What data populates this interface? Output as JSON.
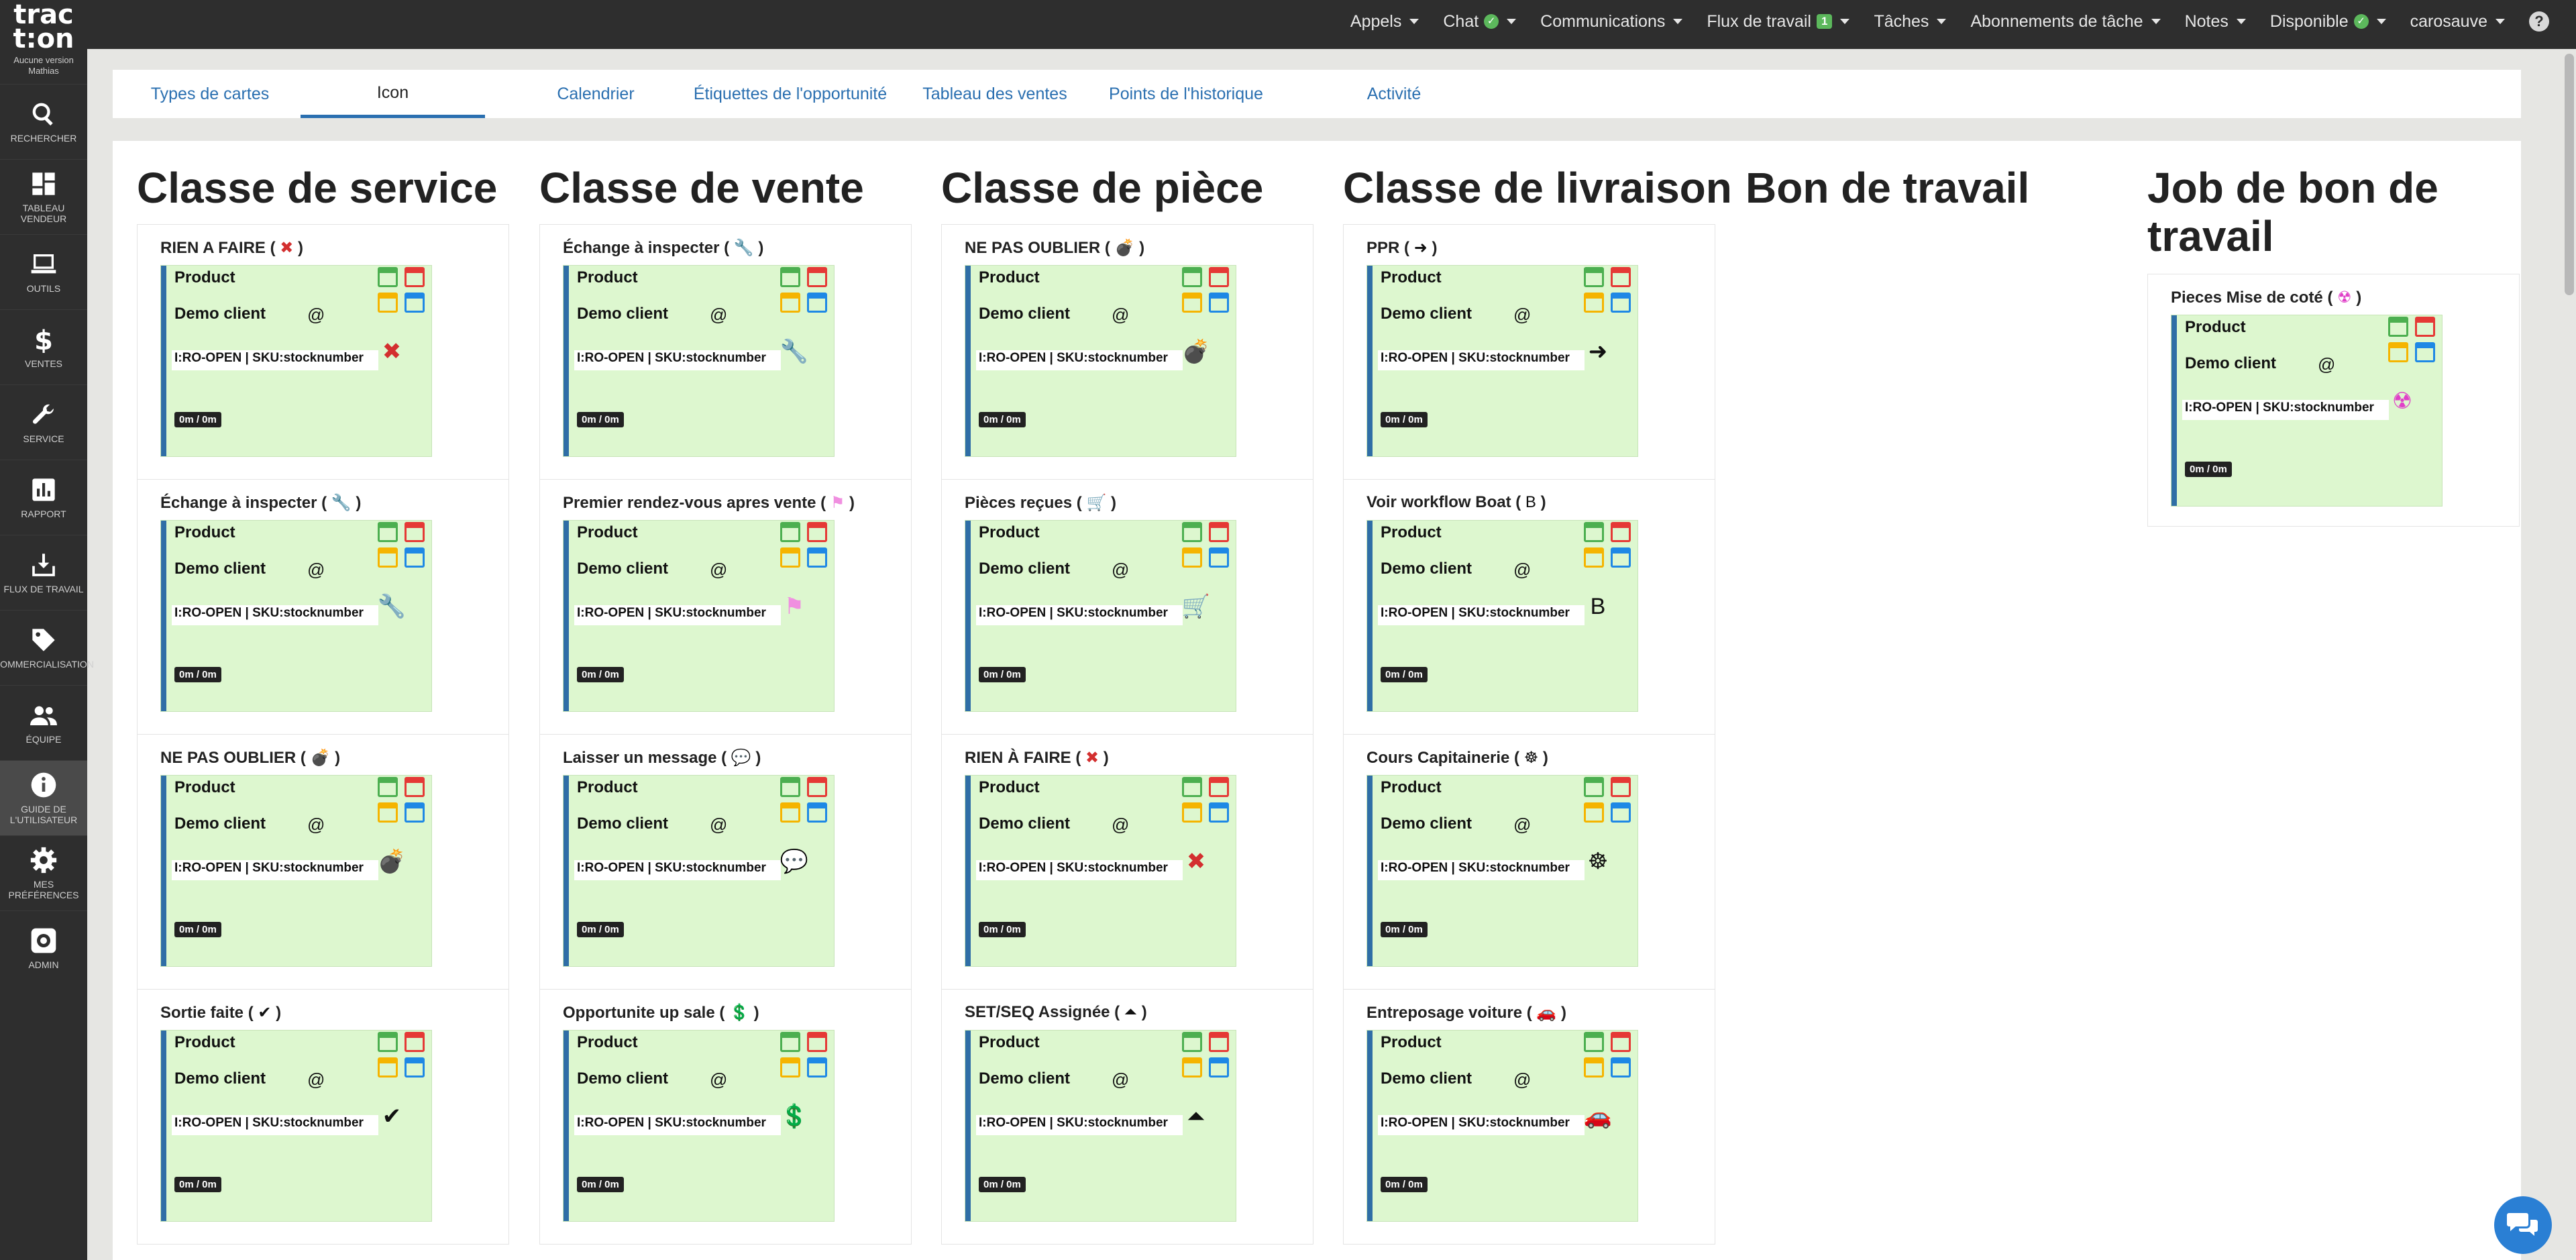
{
  "sidebar": {
    "logo_line1": "trac",
    "logo_line2": "t:on",
    "version_line1": "Aucune version",
    "version_line2": "Mathias",
    "items": [
      {
        "label": "RECHERCHER"
      },
      {
        "label": "TABLEAU VENDEUR"
      },
      {
        "label": "OUTILS"
      },
      {
        "label": "VENTES"
      },
      {
        "label": "SERVICE"
      },
      {
        "label": "RAPPORT"
      },
      {
        "label": "FLUX DE TRAVAIL"
      },
      {
        "label": "COMMERCIALISATION"
      },
      {
        "label": "ÉQUIPE"
      },
      {
        "label": "GUIDE DE L'UTILISATEUR"
      },
      {
        "label": "MES PRÉFÉRENCES"
      },
      {
        "label": "ADMIN"
      }
    ]
  },
  "topmenu": {
    "appels": "Appels",
    "chat": "Chat",
    "communications": "Communications",
    "flux": "Flux de travail",
    "flux_badge": "1",
    "taches": "Tâches",
    "abonnements": "Abonnements de tâche",
    "notes": "Notes",
    "disponible": "Disponible",
    "user": "carosauve",
    "help": "?"
  },
  "tabs": [
    {
      "label": "Types de cartes"
    },
    {
      "label": "Icon"
    },
    {
      "label": "Calendrier"
    },
    {
      "label": "Étiquettes de l'opportunité"
    },
    {
      "label": "Tableau des ventes"
    },
    {
      "label": "Points de l'historique"
    },
    {
      "label": "Activité"
    }
  ],
  "card": {
    "product": "Product",
    "client": "Demo client",
    "at": "@",
    "sku": "I:RO-OPEN | SKU:stocknumber",
    "time": "0m / 0m"
  },
  "columns": [
    {
      "title": "Classe de service",
      "cells": [
        {
          "label": "RIEN A FAIRE",
          "icon": "✖",
          "color": "#d32f2f"
        },
        {
          "label": "Échange à inspecter",
          "icon": "🔧",
          "color": "#e04b3a"
        },
        {
          "label": "NE PAS OUBLIER",
          "icon": "💣",
          "color": "#111111"
        },
        {
          "label": "Sortie faite",
          "icon": "✔",
          "color": "#111111"
        }
      ]
    },
    {
      "title": "Classe de vente",
      "cells": [
        {
          "label": "Échange à inspecter",
          "icon": "🔧",
          "color": "#e04b3a"
        },
        {
          "label": "Premier rendez-vous apres vente",
          "icon": "⚑",
          "color": "#f08fe0"
        },
        {
          "label": "Laisser un message",
          "icon": "💬",
          "color": "#111111"
        },
        {
          "label": "Opportunite up sale",
          "icon": "💲",
          "color": "#111111"
        }
      ]
    },
    {
      "title": "Classe de pièce",
      "cells": [
        {
          "label": "NE PAS OUBLIER",
          "icon": "💣",
          "color": "#111111"
        },
        {
          "label": "Pièces reçues",
          "icon": "🛒",
          "color": "#111111"
        },
        {
          "label": "RIEN À FAIRE",
          "icon": "✖",
          "color": "#d32f2f"
        },
        {
          "label": "SET/SEQ Assignée",
          "icon": "⏶",
          "color": "#111111"
        }
      ]
    },
    {
      "title": "Classe de livraison",
      "cells": [
        {
          "label": "PPR",
          "icon": "➜",
          "color": "#111111"
        },
        {
          "label": "Voir workflow Boat",
          "icon": "B",
          "color": "#111111"
        },
        {
          "label": "Cours Capitainerie",
          "icon": "☸",
          "color": "#111111"
        },
        {
          "label": "Entreposage voiture",
          "icon": "🚗",
          "color": "#111111"
        }
      ]
    },
    {
      "title": "Bon de travail",
      "cells": []
    },
    {
      "title": "Job de bon de travail",
      "cells": [
        {
          "label": "Pieces Mise de coté",
          "icon": "☢",
          "color": "#e040c8"
        }
      ]
    }
  ]
}
